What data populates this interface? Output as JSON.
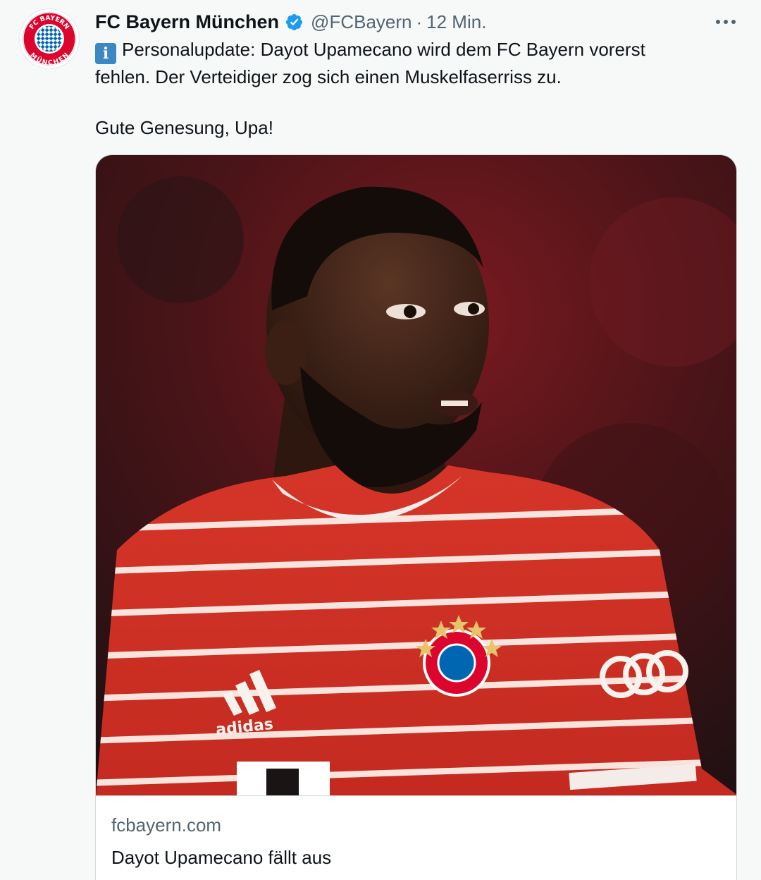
{
  "author": {
    "display_name": "FC Bayern München",
    "handle": "@FCBayern",
    "separator": "·",
    "time": "12 Min.",
    "avatar_icon": "fc-bayern-crest",
    "verified_icon": "verified-badge-icon"
  },
  "menu": {
    "icon": "more-options-icon"
  },
  "tweet": {
    "line1_emoji": "i",
    "line1": "Personalupdate: Dayot Upamecano wird dem FC Bayern vorerst",
    "line2": "fehlen. Der Verteidiger zog sich einen Muskelfaserriss zu.",
    "line3": "Gute Genesung, Upa!"
  },
  "card": {
    "domain": "fcbayern.com",
    "title": "Dayot Upamecano fällt aus",
    "image": "player-photo"
  },
  "colors": {
    "background": "#f7f9f9",
    "text": "#0f1419",
    "muted": "#536471",
    "verified": "#1d9bf0",
    "bayern_red": "#dc052d",
    "bayern_blue": "#0066b2"
  }
}
